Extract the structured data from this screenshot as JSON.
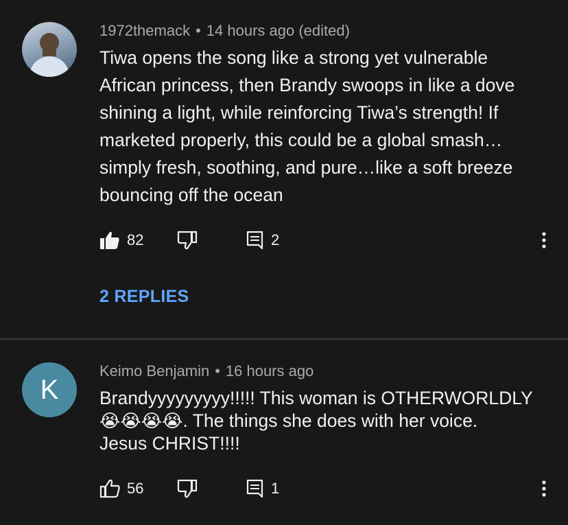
{
  "comments": [
    {
      "author": "1972themack",
      "time": "14 hours ago (edited)",
      "lines": [
        "Tiwa opens the song like a strong yet vulnerable",
        "African princess, then Brandy swoops in like a dove",
        "shining a light, while reinforcing Tiwa’s strength! If",
        "marketed properly, this could be a global smash…",
        "simply fresh, soothing, and pure…like a soft breeze",
        "bouncing off the ocean"
      ],
      "likes": "82",
      "reply_count": "2",
      "liked": true,
      "replies_label": "2 REPLIES"
    },
    {
      "author": "Keimo Benjamin",
      "avatar_letter": "K",
      "time": "16 hours ago",
      "line1": "Brandyyyyyyyyy!!!!! This woman is OTHERWORLDLY",
      "emojis": "😭😭😭😭",
      "line2_rest": ". The things she does with her voice.",
      "line3": "Jesus CHRIST!!!!",
      "likes": "56",
      "reply_count": "1",
      "liked": false
    }
  ],
  "separator": "•",
  "colors": {
    "background": "#181818",
    "link": "#5ea6ff",
    "meta": "#aaaaaa",
    "avatar_k": "#4a8aa0"
  }
}
